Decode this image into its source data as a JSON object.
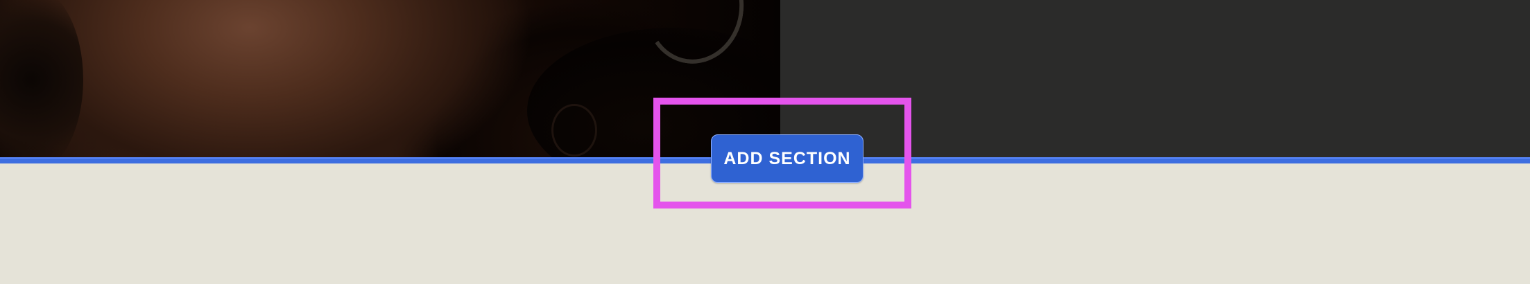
{
  "editor": {
    "add_section_label": "ADD SECTION"
  },
  "colors": {
    "divider": "#3d6ee0",
    "button": "#2f62d2",
    "highlight": "#e454ec",
    "dark_panel": "#2b2b2a",
    "background": "#e5e3d8"
  }
}
